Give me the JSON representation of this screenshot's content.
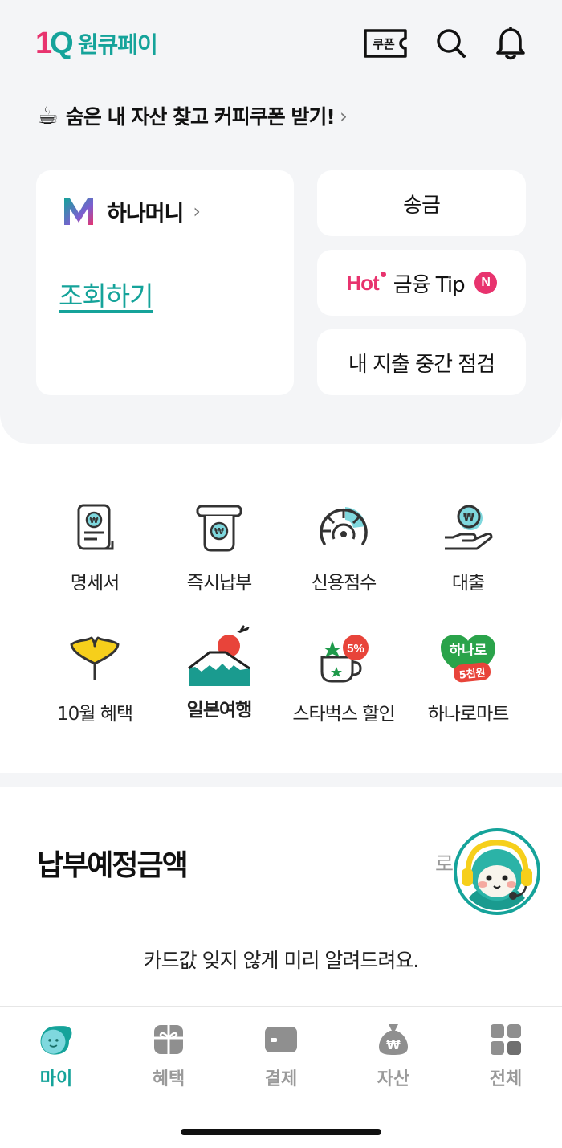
{
  "header": {
    "logo_mark_one": "1",
    "logo_mark_q": "Q",
    "logo_text": "원큐페이",
    "coupon_label": "쿠폰",
    "icons": [
      "coupon-icon",
      "search-icon",
      "bell-icon"
    ]
  },
  "promo": {
    "emoji": "☕",
    "text": "숨은 내 자산 찾고 커피쿠폰 받기!",
    "chevron": "›"
  },
  "hana_money": {
    "logo": "M",
    "title": "하나머니",
    "chevron": "›",
    "link": "조회하기"
  },
  "quick_buttons": {
    "transfer": "송금",
    "hot": "Hot",
    "finance_tip": "금융 Tip",
    "new_badge": "N",
    "spending_check": "내 지출 중간 점검"
  },
  "menu": {
    "statement": "명세서",
    "instant_pay": "즉시납부",
    "credit_score": "신용점수",
    "loan": "대출",
    "october_benefit": "10월 혜택",
    "japan_travel": "일본여행",
    "starbucks": "스타벅스 할인",
    "starbucks_badge": "5%",
    "hanaro_mart": "하나로마트",
    "hanaro_logo": "하나로",
    "hanaro_badge": "5천원"
  },
  "due": {
    "title": "납부예정금액",
    "login": "로그",
    "description": "카드값 잊지 않게 미리 알려드려요."
  },
  "tabs": [
    {
      "label": "마이",
      "icon": "face-icon",
      "active": true
    },
    {
      "label": "혜택",
      "icon": "gift-icon",
      "active": false
    },
    {
      "label": "결제",
      "icon": "card-icon",
      "active": false
    },
    {
      "label": "자산",
      "icon": "money-bag-icon",
      "active": false
    },
    {
      "label": "전체",
      "icon": "grid-icon",
      "active": false
    }
  ],
  "colors": {
    "brand_teal": "#15a39a",
    "brand_pink": "#e8336e",
    "background_gray": "#f4f5f7",
    "ginkgo_yellow": "#f6cf1b",
    "starbucks_green": "#1e9a4a"
  }
}
